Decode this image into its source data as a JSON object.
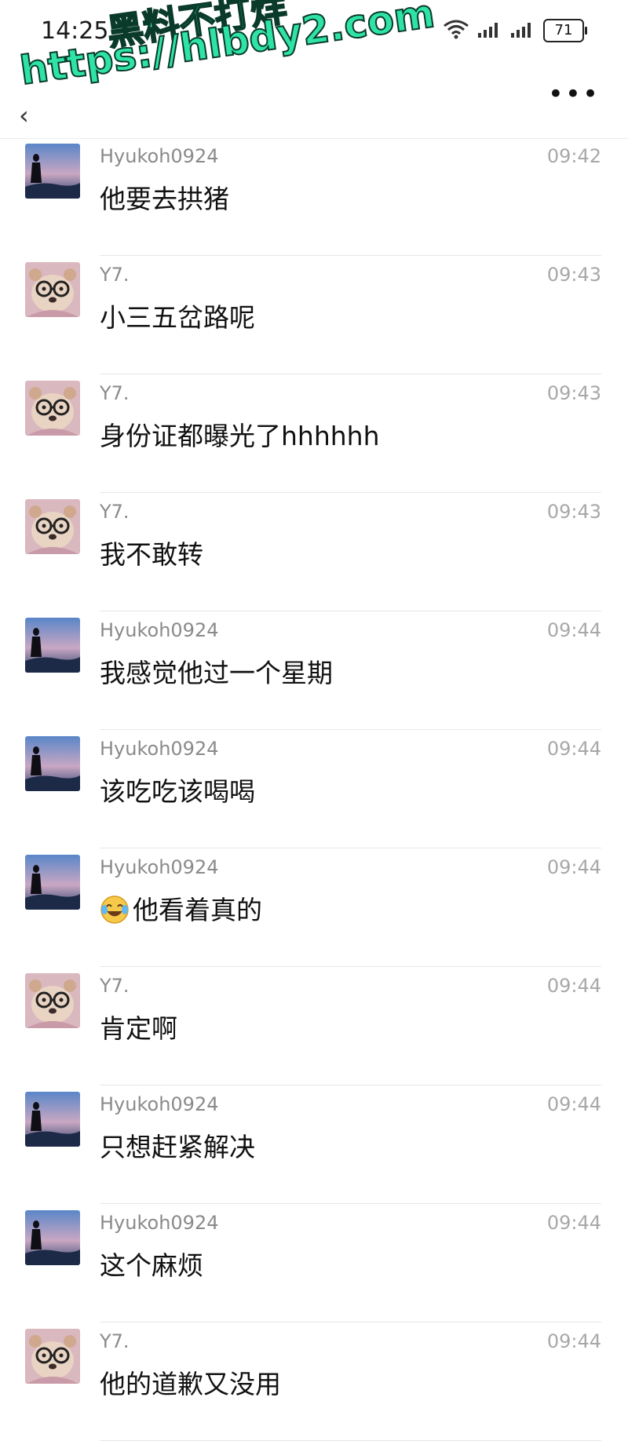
{
  "status_bar": {
    "time": "14:25",
    "battery": "71"
  },
  "watermark": {
    "line1": "黑料不打烊",
    "line2": "https://hlbdy2.com"
  },
  "nav": {
    "more": "•••"
  },
  "messages": [
    {
      "sender": "Hyukoh0924",
      "time": "09:42",
      "text": "他要去拱猪",
      "avatar": "silhouette"
    },
    {
      "sender": "Y7.",
      "time": "09:43",
      "text": "小三五岔路呢",
      "avatar": "bear"
    },
    {
      "sender": "Y7.",
      "time": "09:43",
      "text": "身份证都曝光了hhhhhh",
      "avatar": "bear"
    },
    {
      "sender": "Y7.",
      "time": "09:43",
      "text": "我不敢转",
      "avatar": "bear"
    },
    {
      "sender": "Hyukoh0924",
      "time": "09:44",
      "text": "我感觉他过一个星期",
      "avatar": "silhouette"
    },
    {
      "sender": "Hyukoh0924",
      "time": "09:44",
      "text": "该吃吃该喝喝",
      "avatar": "silhouette"
    },
    {
      "sender": "Hyukoh0924",
      "time": "09:44",
      "text": "他看着真的",
      "avatar": "silhouette",
      "emoji": "laughing-crying-emoji"
    },
    {
      "sender": "Y7.",
      "time": "09:44",
      "text": "肯定啊",
      "avatar": "bear"
    },
    {
      "sender": "Hyukoh0924",
      "time": "09:44",
      "text": "只想赶紧解决",
      "avatar": "silhouette"
    },
    {
      "sender": "Hyukoh0924",
      "time": "09:44",
      "text": "这个麻烦",
      "avatar": "silhouette"
    },
    {
      "sender": "Y7.",
      "time": "09:44",
      "text": "他的道歉又没用",
      "avatar": "bear"
    }
  ]
}
